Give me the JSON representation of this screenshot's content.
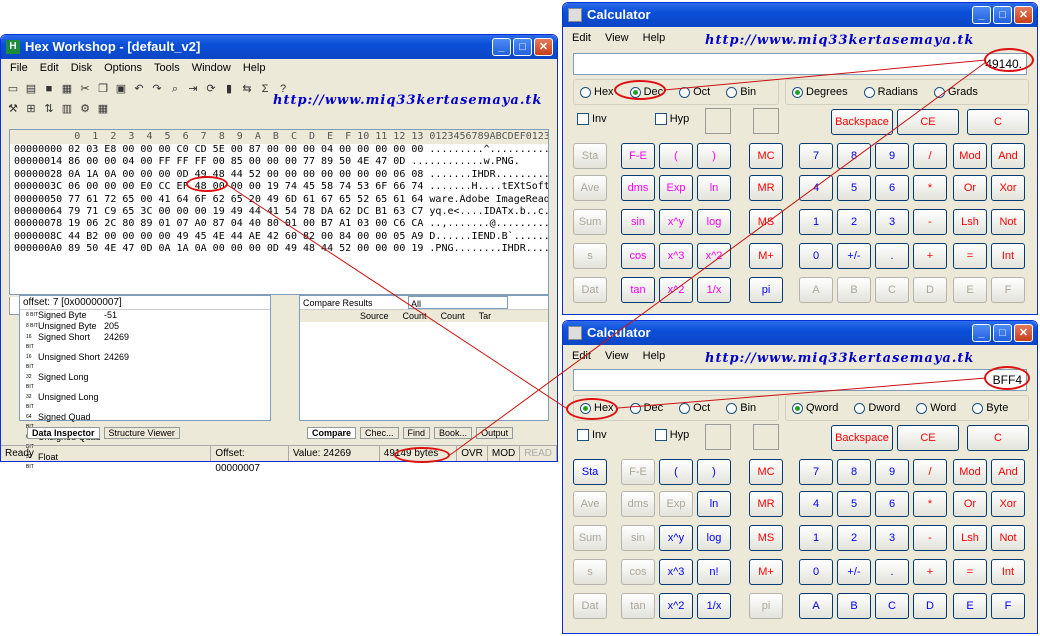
{
  "hexworkshop": {
    "title": "Hex Workshop - [default_v2]",
    "menu": [
      "File",
      "Edit",
      "Disk",
      "Options",
      "Tools",
      "Window",
      "Help"
    ],
    "watermark": "http://www.miq33kertasemaya.tk",
    "header": "          0  1  2  3  4  5  6  7  8  9  A  B  C  D  E  F 10 11 12 13 0123456789ABCDEF0123",
    "rows": [
      "00000000 02 03 E8 00 00 00 C0 CD 5E 00 87 00 00 00 04 00 00 00 00 00 .........^..........",
      "00000014 86 00 00 04 00 FF FF FF 00 85 00 00 00 77 89 50 4E 47 0D ............w.PNG.",
      "00000028 0A 1A 0A 00 00 00 0D 49 48 44 52 00 00 00 00 00 00 00 06 08 .......IHDR.........",
      "0000003C 06 00 00 00 E0 CC EF 48 00 00 00 19 74 45 58 74 53 6F 66 74 .......H....tEXtSoft",
      "00000050 77 61 72 65 00 41 64 6F 62 65 20 49 6D 61 67 65 52 65 61 64 ware.Adobe ImageRead",
      "00000064 79 71 C9 65 3C 00 00 00 19 49 44 41 54 78 DA 62 DC B1 63 C7 yq.e<....IDATx.b..c.",
      "00000078 19 06 2C 80 89 01 07 A0 87 04 40 80 01 00 B7 A1 03 00 C6 CA ..,.......@.........",
      "0000008C 44 B2 00 00 00 00 49 45 4E 44 AE 42 60 82 00 84 00 00 05 A9 D......IEND.B`......",
      "000000A0 89 50 4E 47 0D 0A 1A 0A 00 00 00 0D 49 48 44 52 00 00 00 19 .PNG........IHDR...."
    ],
    "file_tab": "default_v2",
    "offset_label": "offset: 7 [0x00000007]",
    "inspector": [
      {
        "type": "8 BIT",
        "name": "Signed Byte",
        "value": "-51"
      },
      {
        "type": "8 BIT",
        "name": "Unsigned Byte",
        "value": "205"
      },
      {
        "type": "16 BIT",
        "name": "Signed Short",
        "value": "24269"
      },
      {
        "type": "16 BIT",
        "name": "Unsigned Short",
        "value": "24269"
      },
      {
        "type": "32 BIT",
        "name": "Signed Long",
        "value": ""
      },
      {
        "type": "32 BIT",
        "name": "Unsigned Long",
        "value": ""
      },
      {
        "type": "64 BIT",
        "name": "Signed Quad",
        "value": ""
      },
      {
        "type": "64 BIT",
        "name": "Unsigned Quad",
        "value": ""
      },
      {
        "type": "32 BIT",
        "name": "Float",
        "value": ""
      }
    ],
    "tabs_left": [
      "Data Inspector",
      "Structure Viewer"
    ],
    "compare_label": "Compare Results",
    "compare_filter": "All",
    "compare_cols": [
      "Source",
      "Count",
      "Count",
      "Tar"
    ],
    "tabs_right": [
      "Compare",
      "Chec...",
      "Find",
      "Book...",
      "Output"
    ],
    "status": [
      "Ready",
      "Offset: 00000007",
      "Value: 24269",
      "49149 bytes",
      "OVR",
      "MOD",
      "READ"
    ]
  },
  "calc_dec": {
    "title": "Calculator",
    "menu": [
      "Edit",
      "View",
      "Help"
    ],
    "watermark": "http://www.miq33kertasemaya.tk",
    "display": "49140.",
    "bases": [
      "Hex",
      "Dec",
      "Oct",
      "Bin"
    ],
    "angles": [
      "Degrees",
      "Radians",
      "Grads"
    ],
    "checks": [
      "Inv",
      "Hyp"
    ],
    "top": [
      "Backspace",
      "CE",
      "C"
    ],
    "left": [
      "Sta",
      "Ave",
      "Sum",
      "s",
      "Dat"
    ],
    "sci": [
      [
        "F-E",
        "(",
        ")"
      ],
      [
        "dms",
        "Exp",
        "ln"
      ],
      [
        "sin",
        "x^y",
        "log"
      ],
      [
        "cos",
        "x^3",
        "x^2"
      ],
      [
        "tan",
        "x^2",
        "1/x"
      ]
    ],
    "mem": [
      "MC",
      "MR",
      "MS",
      "M+",
      "pi"
    ],
    "num": [
      [
        "7",
        "8",
        "9",
        "/",
        "Mod",
        "And"
      ],
      [
        "4",
        "5",
        "6",
        "*",
        "Or",
        "Xor"
      ],
      [
        "1",
        "2",
        "3",
        "-",
        "Lsh",
        "Not"
      ],
      [
        "0",
        "+/-",
        ".",
        "+",
        "=",
        "Int"
      ],
      [
        "A",
        "B",
        "C",
        "D",
        "E",
        "F"
      ]
    ]
  },
  "calc_hex": {
    "title": "Calculator",
    "menu": [
      "Edit",
      "View",
      "Help"
    ],
    "watermark": "http://www.miq33kertasemaya.tk",
    "display": "BFF4",
    "bases": [
      "Hex",
      "Dec",
      "Oct",
      "Bin"
    ],
    "words": [
      "Qword",
      "Dword",
      "Word",
      "Byte"
    ],
    "checks": [
      "Inv",
      "Hyp"
    ],
    "top": [
      "Backspace",
      "CE",
      "C"
    ],
    "left": [
      "Sta",
      "Ave",
      "Sum",
      "s",
      "Dat"
    ],
    "sci": [
      [
        "F-E",
        "(",
        ")"
      ],
      [
        "dms",
        "Exp",
        "ln"
      ],
      [
        "sin",
        "x^y",
        "log"
      ],
      [
        "cos",
        "x^3",
        "n!"
      ],
      [
        "tan",
        "x^2",
        "1/x"
      ]
    ],
    "mem": [
      "MC",
      "MR",
      "MS",
      "M+",
      "pi"
    ],
    "num": [
      [
        "7",
        "8",
        "9",
        "/",
        "Mod",
        "And"
      ],
      [
        "4",
        "5",
        "6",
        "*",
        "Or",
        "Xor"
      ],
      [
        "1",
        "2",
        "3",
        "-",
        "Lsh",
        "Not"
      ],
      [
        "0",
        "+/-",
        ".",
        "+",
        "=",
        "Int"
      ],
      [
        "A",
        "B",
        "C",
        "D",
        "E",
        "F"
      ]
    ]
  },
  "colors": {
    "annotation": "#dd1111",
    "titlebar": "#0a4fd8"
  }
}
